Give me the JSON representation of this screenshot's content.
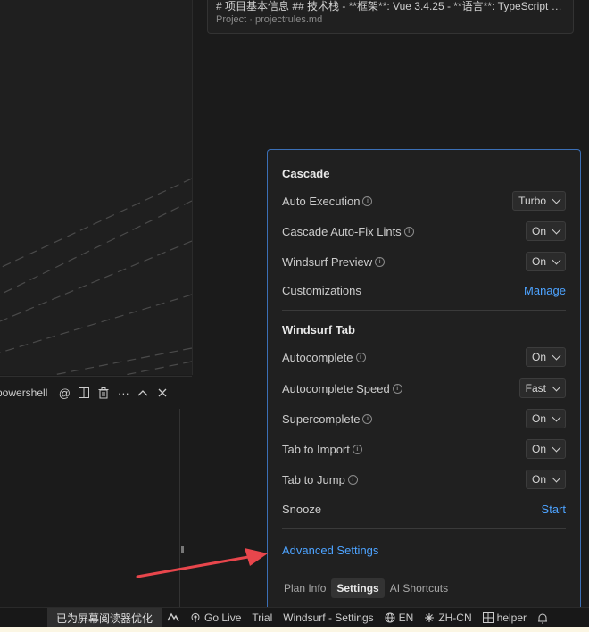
{
  "suggestion": {
    "title": "# 项目基本信息 ## 技术栈 - **框架**: Vue 3.4.25 - **语言**: TypeScript 4....",
    "subtitle": "Project · projectrules.md"
  },
  "terminal": {
    "label": "powershell",
    "icons": [
      "at-icon",
      "split-icon",
      "trash-icon",
      "more-icon",
      "chevron-up-icon",
      "close-icon"
    ]
  },
  "panel": {
    "cascade": {
      "title": "Cascade",
      "auto_execution": {
        "label": "Auto Execution",
        "value": "Turbo"
      },
      "auto_fix": {
        "label": "Cascade Auto-Fix Lints",
        "value": "On"
      },
      "preview": {
        "label": "Windsurf Preview",
        "value": "On"
      },
      "customizations": {
        "label": "Customizations",
        "action": "Manage"
      }
    },
    "tab": {
      "title": "Windsurf Tab",
      "autocomplete": {
        "label": "Autocomplete",
        "value": "On"
      },
      "speed": {
        "label": "Autocomplete Speed",
        "value": "Fast"
      },
      "supercomplete": {
        "label": "Supercomplete",
        "value": "On"
      },
      "tab_import": {
        "label": "Tab to Import",
        "value": "On"
      },
      "tab_jump": {
        "label": "Tab to Jump",
        "value": "On"
      },
      "snooze": {
        "label": "Snooze",
        "action": "Start"
      }
    },
    "advanced": "Advanced Settings",
    "tabs": {
      "plan": "Plan Info",
      "settings": "Settings",
      "shortcuts": "AI Shortcuts"
    }
  },
  "statusbar": {
    "screen_reader": "已为屏幕阅读器优化",
    "go_live": "Go Live",
    "trial": "Trial",
    "settings": "Windsurf - Settings",
    "lang_en": "EN",
    "lang_zh": "ZH-CN",
    "helper": "helper"
  },
  "colors": {
    "accent": "#4da3ff",
    "panel_border": "#3b6fb6",
    "arrow": "#e8464c"
  }
}
